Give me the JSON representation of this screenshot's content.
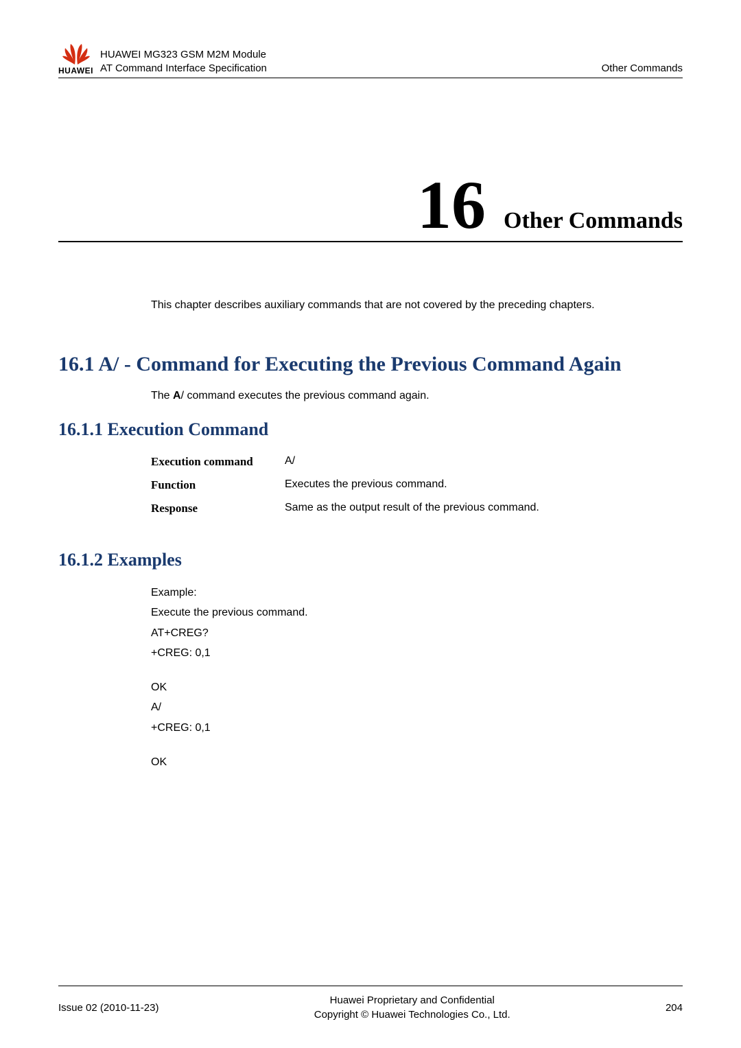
{
  "header": {
    "logo_text": "HUAWEI",
    "title_line1": "HUAWEI MG323 GSM M2M Module",
    "title_line2": "AT Command Interface Specification",
    "right": "Other Commands"
  },
  "chapter": {
    "number": "16",
    "title": "Other Commands"
  },
  "intro": "This chapter describes auxiliary commands that are not covered by the preceding chapters.",
  "section1": {
    "heading": "16.1 A/ - Command for Executing the Previous Command Again",
    "desc_prefix": "The ",
    "desc_bold": "A",
    "desc_suffix": "/ command executes the previous command again."
  },
  "subsection1": {
    "heading": "16.1.1 Execution Command",
    "rows": [
      {
        "label": "Execution command",
        "value": "A/"
      },
      {
        "label": "Function",
        "value": "Executes the previous command."
      },
      {
        "label": "Response",
        "value": "Same as the output result of the previous command."
      }
    ]
  },
  "subsection2": {
    "heading": "16.1.2 Examples",
    "lines": [
      "Example:",
      "Execute the previous command.",
      "AT+CREG?",
      "+CREG: 0,1",
      "",
      "OK",
      "A/",
      "+CREG: 0,1",
      "",
      "OK"
    ]
  },
  "footer": {
    "left": "Issue 02 (2010-11-23)",
    "center_line1": "Huawei Proprietary and Confidential",
    "center_line2": "Copyright © Huawei Technologies Co., Ltd.",
    "right": "204"
  }
}
